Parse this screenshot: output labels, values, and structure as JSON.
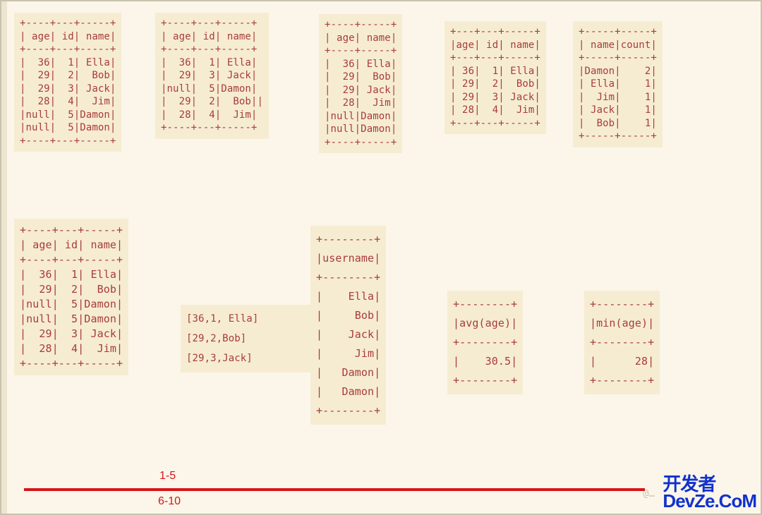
{
  "panel1": "+----+---+-----+\n| age| id| name|\n+----+---+-----+\n|  36|  1| Ella|\n|  29|  2|  Bob|\n|  29|  3| Jack|\n|  28|  4|  Jim|\n|null|  5|Damon|\n|null|  5|Damon|\n+----+---+-----+",
  "panel2": "+----+---+-----+\n| age| id| name|\n+----+---+-----+\n|  36|  1| Ella|\n|  29|  3| Jack|\n|null|  5|Damon|\n|  29|  2|  Bob||\n|  28|  4|  Jim|\n+----+---+-----+",
  "panel3": "+----+-----+\n| age| name|\n+----+-----+\n|  36| Ella|\n|  29|  Bob|\n|  29| Jack|\n|  28|  Jim|\n|null|Damon|\n|null|Damon|\n+----+-----+",
  "panel4": "+---+---+-----+\n|age| id| name|\n+---+---+-----+\n| 36|  1| Ella|\n| 29|  2|  Bob|\n| 29|  3| Jack|\n| 28|  4|  Jim|\n+---+---+-----+",
  "panel5": "+-----+-----+\n| name|count|\n+-----+-----+\n|Damon|    2|\n| Ella|    1|\n|  Jim|    1|\n| Jack|    1|\n|  Bob|    1|\n+-----+-----+",
  "panel6": "+----+---+-----+\n| age| id| name|\n+----+---+-----+\n|  36|  1| Ella|\n|  29|  2|  Bob|\n|null|  5|Damon|\n|null|  5|Damon|\n|  29|  3| Jack|\n|  28|  4|  Jim|\n+----+---+-----+",
  "panel7": "[36,1, Ella]\n[29,2,Bob]\n[29,3,Jack]",
  "panel8": "+--------+\n|username|\n+--------+\n|    Ella|\n|     Bob|\n|    Jack|\n|     Jim|\n|   Damon|\n|   Damon|\n+--------+",
  "panel9": "+--------+\n|avg(age)|\n+--------+\n|    30.5|\n+--------+",
  "panel10": "+--------+\n|min(age)|\n+--------+\n|      28|\n+--------+",
  "labelTop": "1-5",
  "labelBottom": "6-10",
  "watermark1": "开发者",
  "watermark2": "DevZe.CoM",
  "faint": "@…"
}
